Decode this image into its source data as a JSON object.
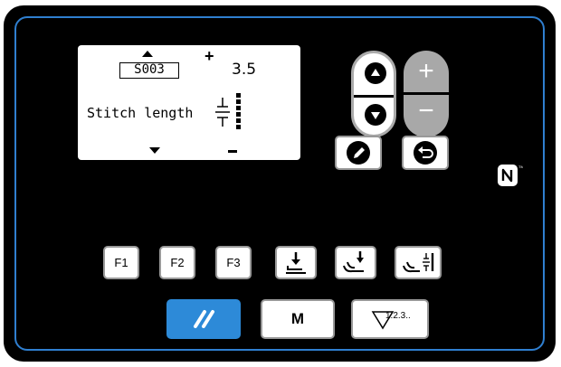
{
  "lcd": {
    "program": "S003",
    "value": "3.5",
    "label": "Stitch length"
  },
  "buttons": {
    "f1": "F1",
    "f2": "F2",
    "f3": "F3",
    "m": "M",
    "count_symbol": "1.2.3.."
  },
  "colors": {
    "panel": "#000000",
    "border": "#2f7fd0",
    "accent": "#2d8ad8",
    "adjust": "#a8a8a8"
  }
}
